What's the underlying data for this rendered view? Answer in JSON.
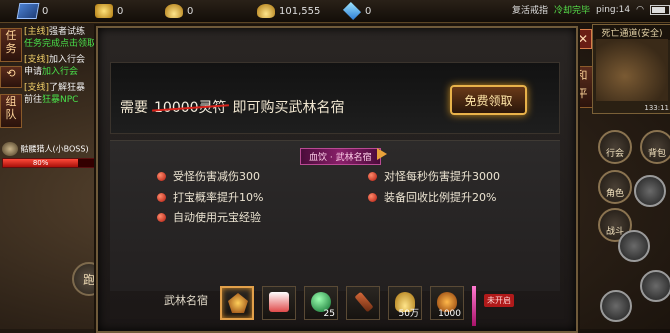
{
  "topbar": {
    "resources": [
      {
        "icon": "skill-book-icon",
        "value": "0"
      },
      {
        "icon": "gold-coin-icon",
        "value": "0"
      },
      {
        "icon": "gold-ingot-icon",
        "value": "0"
      },
      {
        "icon": "ingot-stack-icon",
        "value": "101,555"
      },
      {
        "icon": "diamond-icon",
        "value": "0"
      }
    ],
    "revive_text": "复活戒指",
    "cooldown_text": "冷却完毕",
    "ping": "ping:14"
  },
  "left": {
    "task_btn": "任务",
    "team_btn": "组队",
    "quests": [
      {
        "tag": "[主线]",
        "title": "强者试练",
        "desc": "任务完成点击领取"
      },
      {
        "tag": "[支线]",
        "title": "加入行会",
        "desc_prefix": "申请",
        "desc_link": "加入行会"
      },
      {
        "tag": "[支线]",
        "title": "了解狂暴",
        "desc_prefix": "前往",
        "desc_link": "狂暴NPC"
      }
    ],
    "target": {
      "name": "骷髅猎人(小BOSS)",
      "hp": "80%"
    },
    "run_label": "跑"
  },
  "right": {
    "map_title": "死亡通道(安全)",
    "map_coord": "133:11",
    "peace_tab": "和平",
    "buttons": {
      "bag": "背包",
      "role": "角色",
      "guild": "行会",
      "battle": "战斗"
    }
  },
  "popup": {
    "need_label": "需要",
    "old_price": "10000灵符",
    "buy_text": "即可购买武林名宿",
    "free_button": "免费领取",
    "section_title": "血饮 · 武林名宿",
    "perks_left": [
      "受怪伤害减伤300",
      "打宝概率提升10%",
      "自动使用元宝经验"
    ],
    "perks_right": [
      "对怪每秒伤害提升3000",
      "装备回收比例提升20%"
    ],
    "title_label": "武林名宿",
    "rewards": [
      {
        "icon": "emblem-icon",
        "qty": ""
      },
      {
        "icon": "gift-box-icon",
        "qty": ""
      },
      {
        "icon": "green-orb-icon",
        "qty": "25"
      },
      {
        "icon": "scroll-icon",
        "qty": ""
      },
      {
        "icon": "gold-ingot-icon",
        "qty": "50万"
      },
      {
        "icon": "gourd-icon",
        "qty": "1000"
      }
    ],
    "not_open_badge": "未开启"
  }
}
